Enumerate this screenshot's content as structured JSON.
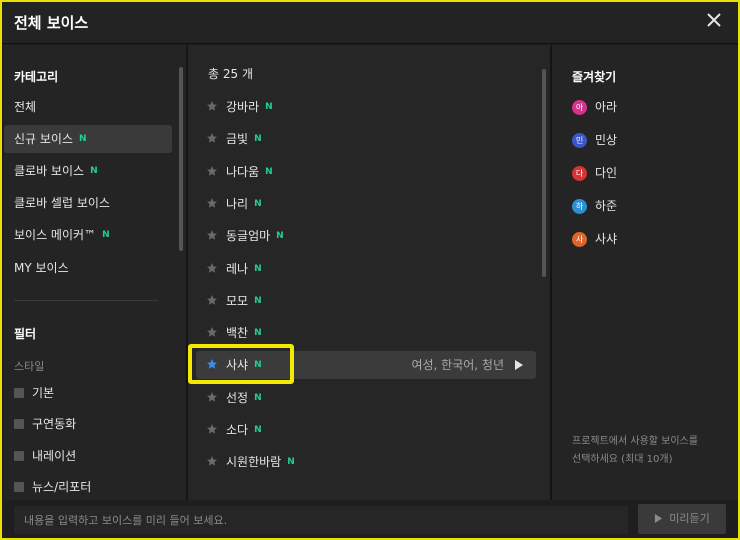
{
  "dialog": {
    "title": "전체 보이스"
  },
  "left": {
    "category_title": "카테고리",
    "categories": [
      {
        "label": "전체",
        "new": false,
        "active": false
      },
      {
        "label": "신규 보이스",
        "new": true,
        "active": true
      },
      {
        "label": "클로바 보이스",
        "new": true,
        "active": false
      },
      {
        "label": "클로바 셀럽 보이스",
        "new": false,
        "active": false
      },
      {
        "label": "보이스 메이커™",
        "new": true,
        "active": false
      },
      {
        "label": "MY 보이스",
        "new": false,
        "active": false
      }
    ],
    "filter_title": "필터",
    "style_label": "스타일",
    "filters": [
      "기본",
      "구연동화",
      "내레이션",
      "뉴스/리포터"
    ]
  },
  "middle": {
    "count_text": "총 25 개",
    "new_badge": "N",
    "voices": [
      {
        "name": "강바라",
        "new": true
      },
      {
        "name": "금빛",
        "new": true
      },
      {
        "name": "나다움",
        "new": true
      },
      {
        "name": "나리",
        "new": true
      },
      {
        "name": "동글엄마",
        "new": true
      },
      {
        "name": "레나",
        "new": true
      },
      {
        "name": "모모",
        "new": true
      },
      {
        "name": "백찬",
        "new": true
      },
      {
        "name": "사샤",
        "new": true,
        "selected": true,
        "favorite": true,
        "meta": "여성, 한국어, 청년"
      },
      {
        "name": "선정",
        "new": true
      },
      {
        "name": "소다",
        "new": true
      },
      {
        "name": "시원한바람",
        "new": true
      }
    ]
  },
  "right": {
    "favorites_title": "즐겨찾기",
    "favorites": [
      {
        "badge": "아",
        "name": "아라",
        "color": "#d6338a"
      },
      {
        "badge": "민",
        "name": "민상",
        "color": "#3a56c9"
      },
      {
        "badge": "다",
        "name": "다인",
        "color": "#d63333"
      },
      {
        "badge": "하",
        "name": "하준",
        "color": "#2b8fd6"
      },
      {
        "badge": "사",
        "name": "사샤",
        "color": "#e0652c"
      }
    ],
    "hint_line1": "프로젝트에서 사용할 보이스를",
    "hint_line2": "선택하세요 (최대 10개)"
  },
  "bottom": {
    "input_placeholder": "내용을 입력하고 보이스를 미리 들어 보세요.",
    "preview_label": "미리듣기"
  },
  "colors": {
    "accent": "#1fd18f",
    "highlight": "#f2ea00",
    "star_active": "#3b8eea"
  }
}
